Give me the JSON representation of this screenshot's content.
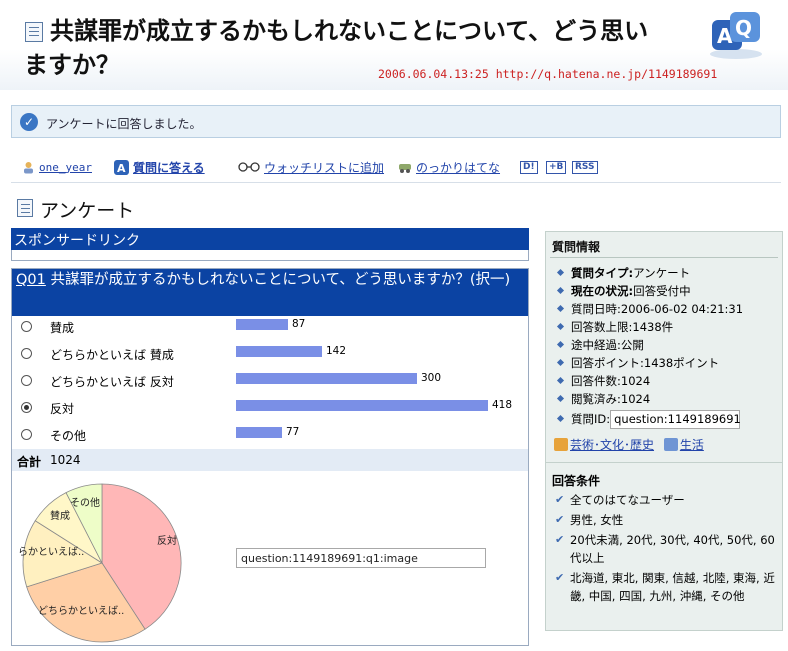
{
  "header": {
    "title_line1": "共謀罪が成立するかもしれないことについて、どう思い",
    "title_line2": "ますか？",
    "meta": "2006.06.04.13:25  http://q.hatena.ne.jp/1149189691",
    "logo_text": "AQ"
  },
  "notice": {
    "text": "アンケートに回答しました。"
  },
  "toolbar": {
    "user": "one_year",
    "answer": "質問に答える",
    "watchlist": "ウォッチリストに追加",
    "nokkari": "のっかりはてな",
    "badge_d": "D!",
    "badge_b": "+B",
    "badge_rss": "RSS"
  },
  "section": {
    "title": "アンケート"
  },
  "sponsor": {
    "title": "スポンサードリンク"
  },
  "question": {
    "number": "Q01",
    "text": "共謀罪が成立するかもしれないことについて、どう思いますか？(択一)",
    "options": [
      {
        "label": "賛成",
        "count": "87",
        "selected": false
      },
      {
        "label": "どちらかといえば 賛成",
        "count": "142",
        "selected": false
      },
      {
        "label": "どちらかといえば 反対",
        "count": "300",
        "selected": false
      },
      {
        "label": "反対",
        "count": "418",
        "selected": true
      },
      {
        "label": "その他",
        "count": "77",
        "selected": false
      }
    ],
    "total_label": "合計",
    "total_value": "1024",
    "image_field_value": "question:1149189691:q1:image"
  },
  "chart_data": {
    "type": "pie",
    "slice_labels": [
      "反対",
      "どちらかといえば..",
      "らかといえば..",
      "賛成",
      "その他"
    ],
    "values": [
      418,
      300,
      142,
      87,
      77
    ],
    "colors": [
      "#ffb7b7",
      "#ffcfa6",
      "#fff0c0",
      "#fff7c8",
      "#eefdc8"
    ]
  },
  "info": {
    "heading": "質問情報",
    "rows": [
      {
        "key": "質問タイプ:",
        "value": "アンケート",
        "bold": true
      },
      {
        "key": "現在の状況:",
        "value": "回答受付中",
        "bold": true
      },
      {
        "key": "質問日時:",
        "value": "2006-06-02 04:21:31",
        "bold": false
      },
      {
        "key": "回答数上限:",
        "value": "1438件",
        "bold": false
      },
      {
        "key": "途中経過:",
        "value": "公開",
        "bold": false
      },
      {
        "key": "回答ポイント:",
        "value": "1438ポイント",
        "bold": false
      },
      {
        "key": "回答件数:",
        "value": "1024",
        "bold": false
      },
      {
        "key": "閲覧済み:",
        "value": "1024",
        "bold": false
      }
    ],
    "id_label": "質問ID:",
    "id_value": "question:1149189691",
    "category1": "芸術･文化･歴史",
    "category2": "生活"
  },
  "conditions": {
    "heading": "回答条件",
    "items": [
      "全てのはてなユーザー",
      "男性, 女性",
      "20代未満, 20代, 30代, 40代, 50代, 60代以上",
      "北海道, 東北, 関東, 信越, 北陸, 東海, 近畿, 中国, 四国, 九州, 沖縄, その他"
    ]
  }
}
